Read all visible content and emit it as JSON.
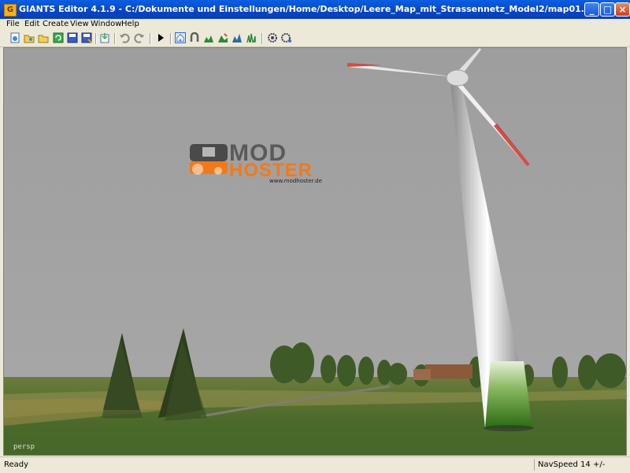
{
  "window": {
    "title": "GIANTS Editor 4.1.9 - C:/Dokumente und Einstellungen/Home/Desktop/Leere_Map_mit_Strassennetz_Model2/map01.i3d",
    "icon_glyph": "G"
  },
  "menu": [
    {
      "label": "File",
      "icon": "none"
    },
    {
      "label": "Edit"
    },
    {
      "label": "Create"
    },
    {
      "label": "View"
    },
    {
      "label": "Window"
    },
    {
      "label": "Help"
    }
  ],
  "toolbar": {
    "icons": [
      "new-icon",
      "open-icon",
      "open-folder-icon",
      "refresh-icon",
      "save-icon",
      "save-as-icon",
      "import-icon",
      "undo-icon",
      "redo-icon",
      "play-icon",
      "home-icon",
      "magnet-icon",
      "terrain-sculpt-icon",
      "terrain-paint-icon",
      "foliage-icon",
      "grass-icon",
      "settings-icon",
      "settings-alt-icon"
    ]
  },
  "viewport": {
    "camera_label": "persp",
    "logo": {
      "line1": "MOD",
      "line2": "HOSTER",
      "url": "www.modhoster.de"
    }
  },
  "status": {
    "left": "Ready",
    "right": "NavSpeed 14 +/-"
  },
  "colors": {
    "titlebar": "#0845c4",
    "sky": "#a0a0a0",
    "grass": "#4b6a2c",
    "logo_orange": "#f07a1a"
  }
}
